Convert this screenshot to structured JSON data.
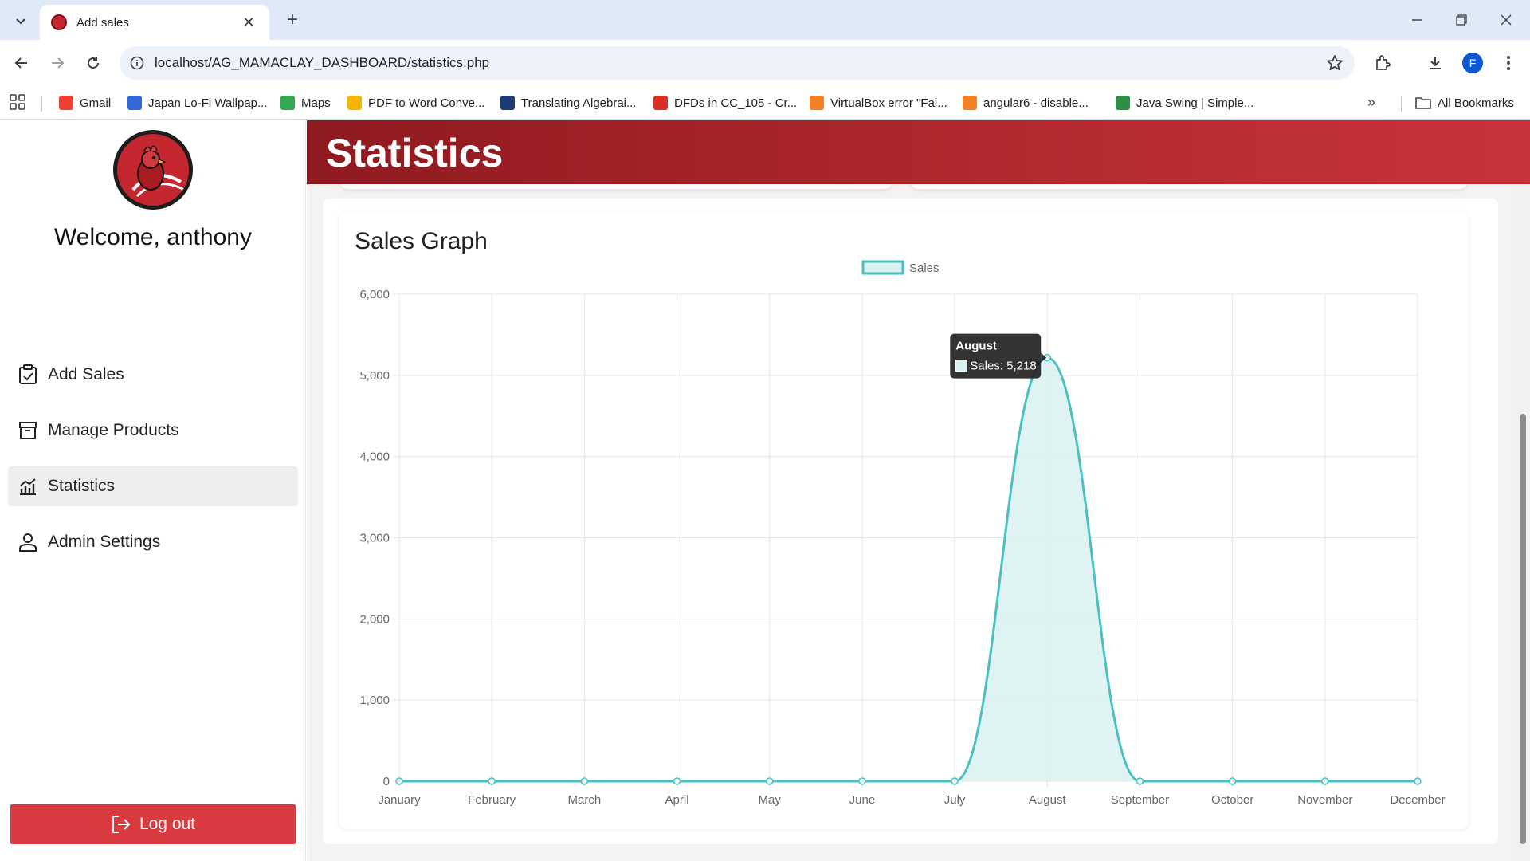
{
  "browser": {
    "tab_title": "Add sales",
    "url": "localhost/AG_MAMACLAY_DASHBOARD/statistics.php",
    "profile_initial": "F",
    "bookmarks": [
      {
        "label": "Gmail",
        "color": "#ea4335"
      },
      {
        "label": "Japan Lo-Fi Wallpap...",
        "color": "#3367d6"
      },
      {
        "label": "Maps",
        "color": "#34a853"
      },
      {
        "label": "PDF to Word Conve...",
        "color": "#f4b400"
      },
      {
        "label": "Translating Algebrai...",
        "color": "#1f3b73"
      },
      {
        "label": "DFDs in CC_105 - Cr...",
        "color": "#d93025"
      },
      {
        "label": "VirtualBox error \"Fai...",
        "color": "#f48024"
      },
      {
        "label": "angular6 - disable...",
        "color": "#f48024"
      },
      {
        "label": "Java Swing | Simple...",
        "color": "#2f8d46"
      }
    ],
    "all_bookmarks_label": "All Bookmarks"
  },
  "sidebar": {
    "welcome": "Welcome, anthony",
    "nav": [
      {
        "label": "Add Sales",
        "icon": "clipboard-check-icon"
      },
      {
        "label": "Manage Products",
        "icon": "archive-icon"
      },
      {
        "label": "Statistics",
        "icon": "chart-icon",
        "active": true
      },
      {
        "label": "Admin Settings",
        "icon": "person-icon"
      }
    ],
    "logout_label": "Log out"
  },
  "header": {
    "title": "Statistics"
  },
  "colors": {
    "accent": "#b32a2f",
    "line": "#4bc0c0",
    "fill": "#d9f1f1"
  },
  "card": {
    "title": "Sales Graph"
  },
  "chart_data": {
    "type": "line",
    "title": "Sales Graph",
    "categories": [
      "January",
      "February",
      "March",
      "April",
      "May",
      "June",
      "July",
      "August",
      "September",
      "October",
      "November",
      "December"
    ],
    "series": [
      {
        "name": "Sales",
        "values": [
          0,
          0,
          0,
          0,
          0,
          0,
          0,
          5218,
          0,
          0,
          0,
          0
        ]
      }
    ],
    "ylim": [
      0,
      6000
    ],
    "yticks": [
      "0",
      "1,000",
      "2,000",
      "3,000",
      "4,000",
      "5,000",
      "6,000"
    ],
    "grid": true,
    "legend": "top-center",
    "tooltip": {
      "title": "August",
      "label": "Sales: 5,218"
    }
  }
}
